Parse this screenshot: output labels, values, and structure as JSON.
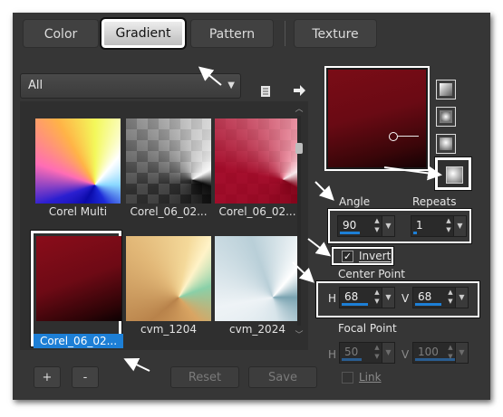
{
  "tabs": [
    {
      "label": "Color",
      "active": false
    },
    {
      "label": "Gradient",
      "active": true
    },
    {
      "label": "Pattern",
      "active": false
    },
    {
      "label": "Texture",
      "active": false
    }
  ],
  "category_select": {
    "value": "All"
  },
  "icons": {
    "save_gradient": "document-icon",
    "import_gradient": "arrow-right-icon"
  },
  "gradients": [
    {
      "label": "Corel Multi",
      "selected": false
    },
    {
      "label": "Corel_06_02...",
      "selected": false
    },
    {
      "label": "Corel_06_02...",
      "selected": false
    },
    {
      "label": "Corel_06_02...",
      "selected": true
    },
    {
      "label": "cvm_1204",
      "selected": false
    },
    {
      "label": "cvm_2024",
      "selected": false
    }
  ],
  "buttons": {
    "add": "+",
    "remove": "-",
    "reset": "Reset",
    "save": "Save"
  },
  "angle": {
    "label": "Angle",
    "value": "90"
  },
  "repeats": {
    "label": "Repeats",
    "value": "1"
  },
  "invert": {
    "label": "Invert",
    "checked": true
  },
  "center_point": {
    "label": "Center Point",
    "h_label": "H",
    "h_value": "68",
    "v_label": "V",
    "v_value": "68"
  },
  "focal_point": {
    "label": "Focal Point",
    "h_label": "H",
    "h_value": "50",
    "v_label": "V",
    "v_value": "100",
    "enabled": false
  },
  "link": {
    "label": "Link",
    "checked": false
  },
  "gradient_styles": [
    "linear",
    "rectangular",
    "sunburst",
    "radial"
  ],
  "selected_style": "radial",
  "colors": {
    "accent": "#1d7fd6",
    "panel": "#363636"
  }
}
